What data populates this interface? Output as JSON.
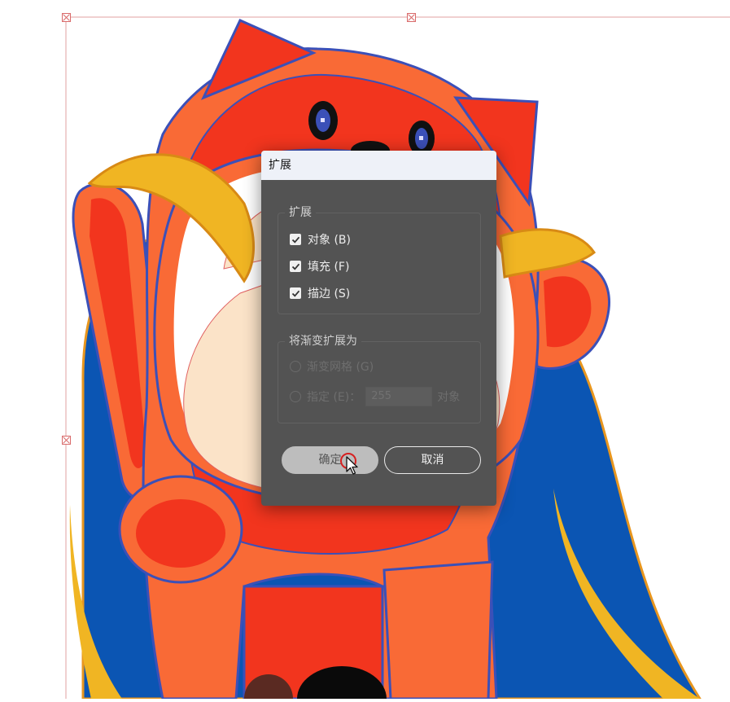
{
  "dialog": {
    "title": "扩展",
    "expand_group": {
      "title": "扩展",
      "options": [
        {
          "label": "对象 (B)",
          "checked": true
        },
        {
          "label": "填充 (F)",
          "checked": true
        },
        {
          "label": "描边 (S)",
          "checked": true
        }
      ]
    },
    "gradient_group": {
      "title": "将渐变扩展为",
      "enabled": false,
      "options": [
        {
          "label": "渐变网格 (G)"
        },
        {
          "label": "指定 (E)：",
          "value": "255",
          "suffix": "对象"
        }
      ]
    },
    "buttons": {
      "ok": "确定",
      "cancel": "取消"
    }
  },
  "colors": {
    "cat_red": "#f2351e",
    "cat_orange": "#f96a36",
    "outline_blue": "#3b50b8",
    "cape_blue": "#0b55b3",
    "scarf_yellow": "#f0b523",
    "belly_cream": "#fbe3c8",
    "dialog_bg": "#535353"
  }
}
